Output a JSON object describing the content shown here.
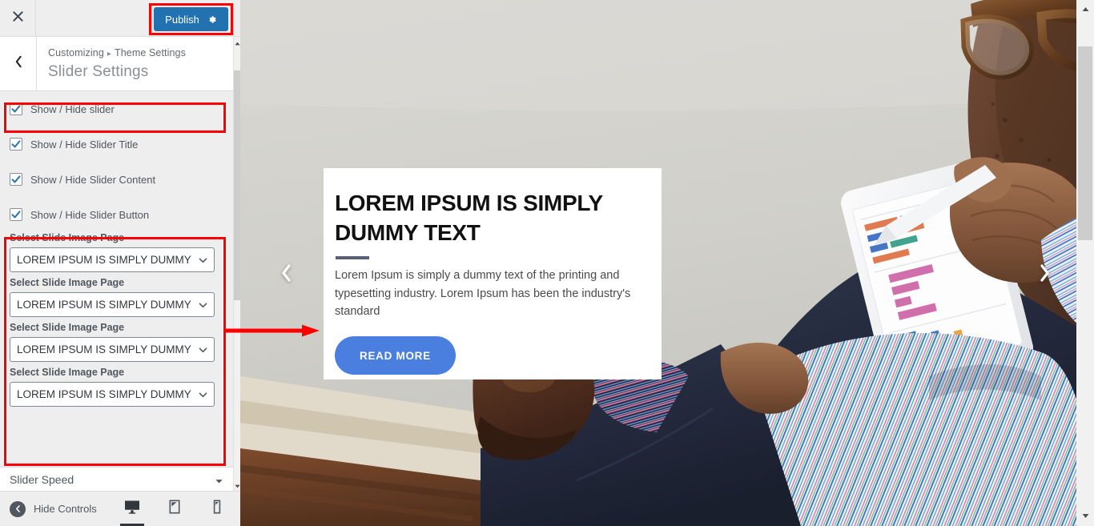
{
  "customizer": {
    "close_icon": "close-icon",
    "publish": {
      "label": "Publish",
      "gear_icon": "gear-icon",
      "color": "#2271b1"
    },
    "back_icon": "chevron-left-icon",
    "breadcrumb": {
      "root": "Customizing",
      "separator": "▸",
      "section": "Theme Settings"
    },
    "panel_title": "Slider Settings",
    "checkboxes": [
      {
        "label": "Show / Hide slider",
        "checked": true
      },
      {
        "label": "Show / Hide Slider Title",
        "checked": true
      },
      {
        "label": "Show / Hide Slider Content",
        "checked": true
      },
      {
        "label": "Show / Hide Slider Button",
        "checked": true
      }
    ],
    "selects": [
      {
        "label": "Select Slide Image Page",
        "value": "LOREM IPSUM IS SIMPLY DUMMY TEXT"
      },
      {
        "label": "Select Slide Image Page",
        "value": "LOREM IPSUM IS SIMPLY DUMMY TEXT"
      },
      {
        "label": "Select Slide Image Page",
        "value": "LOREM IPSUM IS SIMPLY DUMMY TEXT"
      },
      {
        "label": "Select Slide Image Page",
        "value": "LOREM IPSUM IS SIMPLY DUMMY TEXT"
      }
    ],
    "slider_speed": {
      "label": "Slider Speed",
      "caret_icon": "chevron-down-icon"
    },
    "footer": {
      "hide_controls": "Hide Controls",
      "hide_controls_icon": "chevron-left-circle-icon",
      "devices": [
        {
          "name": "desktop",
          "icon": "desktop-icon",
          "active": true
        },
        {
          "name": "tablet",
          "icon": "tablet-icon",
          "active": false
        },
        {
          "name": "mobile",
          "icon": "mobile-icon",
          "active": false
        }
      ]
    },
    "annotation_color": "#fe0000"
  },
  "preview": {
    "slide": {
      "title": "LOREM IPSUM IS SIMPLY DUMMY TEXT",
      "description": "Lorem Ipsum is simply a dummy text of the printing and typesetting industry. Lorem Ipsum has been the industry's standard",
      "button_label": "READ MORE",
      "button_color": "#4a7fe0",
      "rule_color": "#5a6078"
    },
    "carousel": {
      "prev_icon": "chevron-left-icon",
      "next_icon": "chevron-right-icon"
    }
  }
}
